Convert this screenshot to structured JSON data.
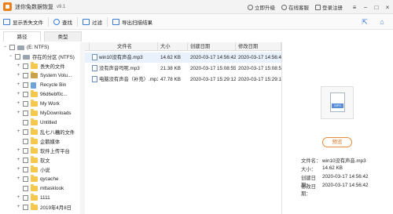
{
  "app": {
    "title": "迷你兔数据恢复",
    "version": "v9.1"
  },
  "title_actions": [
    {
      "label": "立即升级",
      "icon": "upgrade-icon"
    },
    {
      "label": "在线客服",
      "icon": "support-icon"
    },
    {
      "label": "登录注册",
      "icon": "user-icon"
    }
  ],
  "toolbar": {
    "show_deleted": "显示丢失文件",
    "search": "查找",
    "filter": "过滤",
    "export_results": "导出扫描结果"
  },
  "tabs": {
    "path": "路径",
    "type": "类型"
  },
  "tree": [
    {
      "label": "(E: NTFS)",
      "level": 0,
      "expander": "−",
      "icon": "drive"
    },
    {
      "label": "存在的分区 (NTFS)",
      "level": 1,
      "expander": "−",
      "icon": "drive"
    },
    {
      "label": "丢失的文件",
      "level": 2,
      "expander": "+",
      "icon": "folder"
    },
    {
      "label": "System Volu...",
      "level": 2,
      "expander": "+",
      "icon": "sysfolder"
    },
    {
      "label": "Recycle Bin",
      "level": 2,
      "expander": "+",
      "icon": "recycle"
    },
    {
      "label": "96d6ebf0c...",
      "level": 2,
      "expander": "+",
      "icon": "folder"
    },
    {
      "label": "My Work",
      "level": 2,
      "expander": "+",
      "icon": "folder"
    },
    {
      "label": "MyDownloads",
      "level": 2,
      "expander": "+",
      "icon": "folder"
    },
    {
      "label": "Untitled",
      "level": 2,
      "expander": "",
      "icon": "folder"
    },
    {
      "label": "乱七八糟的文件",
      "level": 2,
      "expander": "+",
      "icon": "folder"
    },
    {
      "label": "企鹅媒体",
      "level": 2,
      "expander": "",
      "icon": "folder"
    },
    {
      "label": "软件上传平台",
      "level": 2,
      "expander": "+",
      "icon": "folder"
    },
    {
      "label": "软文",
      "level": 2,
      "expander": "+",
      "icon": "folder"
    },
    {
      "label": "小说",
      "level": 2,
      "expander": "+",
      "icon": "folder"
    },
    {
      "label": "qycache",
      "level": 2,
      "expander": "+",
      "icon": "folder"
    },
    {
      "label": "mttasklook",
      "level": 2,
      "expander": "",
      "icon": "folder"
    },
    {
      "label": "1111",
      "level": 2,
      "expander": "+",
      "icon": "folder"
    },
    {
      "label": "2019年4月8日",
      "level": 2,
      "expander": "+",
      "icon": "folder"
    }
  ],
  "file_table": {
    "headers": [
      "文件名",
      "大小",
      "创建日期",
      "修改日期"
    ],
    "rows": [
      {
        "name": "win10没有声音.mp3",
        "size": "14.62 KB",
        "created": "2020-03-17 14:56:42",
        "modified": "2020-03-17 14:56:42",
        "selected": true
      },
      {
        "name": "没有声音吗呢.mp3",
        "size": "21.38 KB",
        "created": "2020-03-17 15:08:55",
        "modified": "2020-03-17 15:08:55",
        "selected": false
      },
      {
        "name": "电脑没有声音（补充）.mp3",
        "size": "47.78 KB",
        "created": "2020-03-17 15:29:12",
        "modified": "2020-03-17 15:29:12",
        "selected": false
      }
    ]
  },
  "preview": {
    "badge": "MP3",
    "button": "预览",
    "info": [
      {
        "label": "文件名：",
        "value": "win10没有声音.mp3"
      },
      {
        "label": "大小：",
        "value": "14.62 KB"
      },
      {
        "label": "创建日期：",
        "value": "2020-03-17 14:56:42"
      },
      {
        "label": "修改日期：",
        "value": "2020-03-17 14:56:42"
      }
    ]
  }
}
